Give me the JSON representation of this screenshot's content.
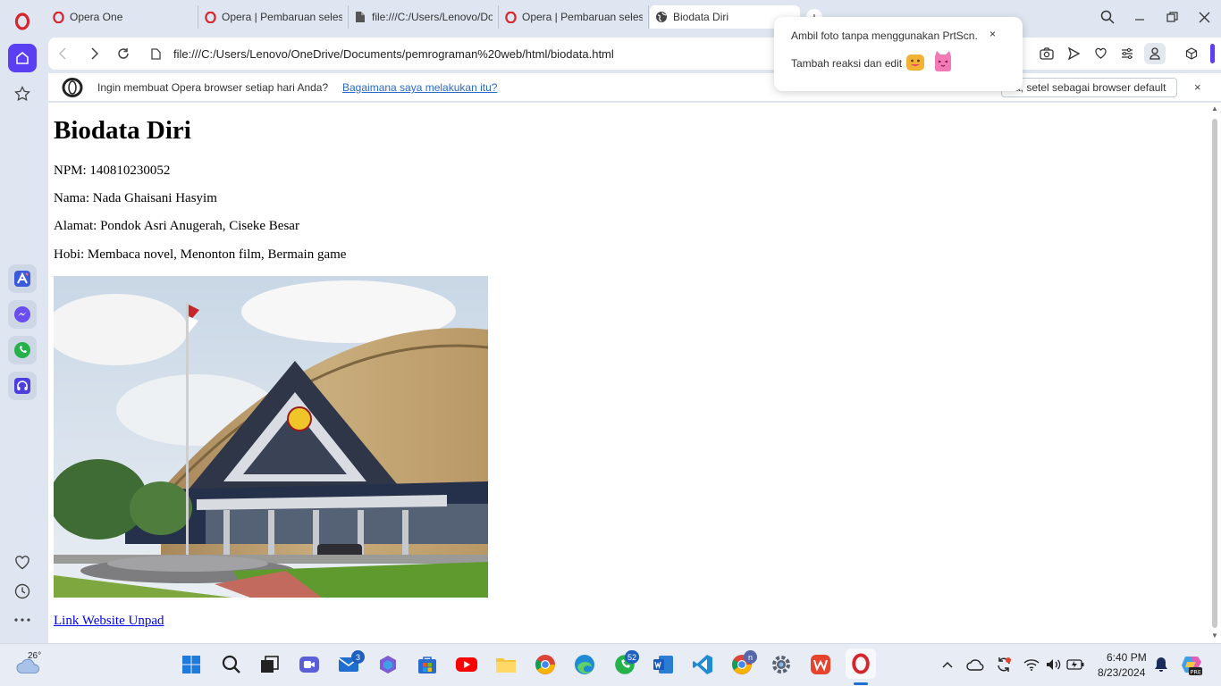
{
  "browser": {
    "tabs": [
      {
        "label": "Opera One",
        "icon": "opera-icon"
      },
      {
        "label": "Opera | Pembaruan selesai",
        "icon": "opera-icon"
      },
      {
        "label": "file:///C:/Users/Lenovo/Do",
        "icon": "file-icon"
      },
      {
        "label": "Opera | Pembaruan selesai",
        "icon": "opera-icon"
      },
      {
        "label": "Biodata Diri",
        "icon": "globe-icon",
        "active": true
      }
    ],
    "new_tab_label": "+",
    "close_label": "✕",
    "url": "file:///C:/Users/Lenovo/OneDrive/Documents/pemrograman%20web/html/biodata.html"
  },
  "popup": {
    "title": "Ambil foto tanpa menggunakan PrtScn.",
    "subtitle": "Tambah reaksi dan edit",
    "close": "×"
  },
  "infobar": {
    "text": "Ingin membuat Opera browser setiap hari Anda?",
    "link": "Bagaimana saya melakukan itu?",
    "button": "a, setel sebagai browser default",
    "close": "×"
  },
  "page": {
    "heading": "Biodata Diri",
    "lines": [
      "NPM: 140810230052",
      "Nama: Nada Ghaisani Hasyim",
      "Alamat: Pondok Asri Anugerah, Ciseke Besar",
      "Hobi: Membaca novel, Menonton film, Bermain game"
    ],
    "link": "Link Website Unpad"
  },
  "taskbar": {
    "weather": "26°",
    "mail_badge": "3",
    "whatsapp_badge": "52",
    "chrome_badge": "n",
    "time": "6:40 PM",
    "date": "8/23/2024"
  },
  "colors": {
    "opera_red": "#d6252c",
    "sidebar_accent": "#5b3ff2",
    "link_blue": "#0000ee"
  }
}
